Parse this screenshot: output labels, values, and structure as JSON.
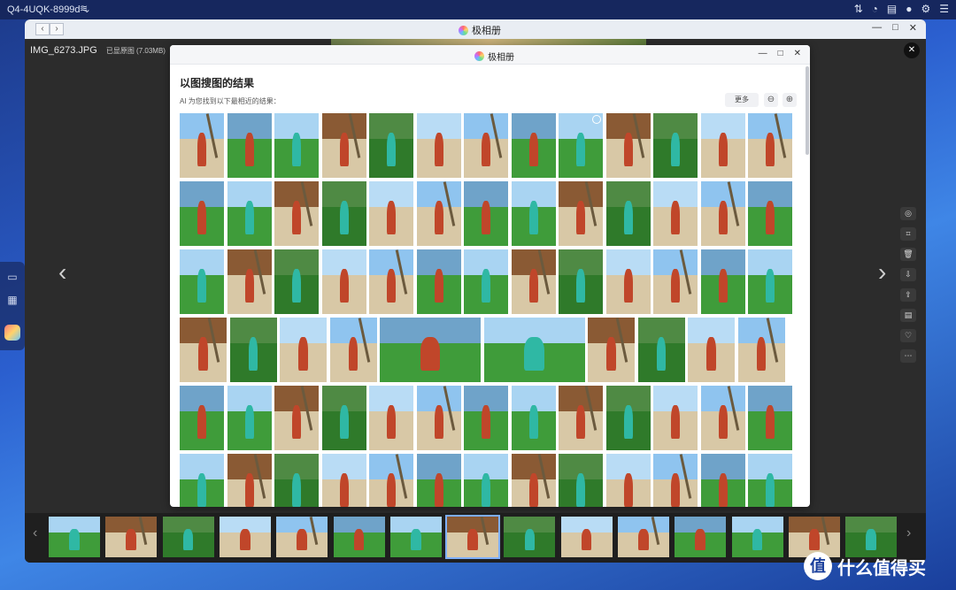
{
  "desktop": {
    "device_name": "Q4-4UQK-8999d",
    "device_chevron": "⌄",
    "wifi_icon": "wifi-icon",
    "top_icons": [
      "transfer-icon",
      "gauge-icon",
      "task-icon",
      "user-icon",
      "gear-icon",
      "menu-icon"
    ]
  },
  "viewer": {
    "title": "极相册",
    "file_name": "IMG_6273.JPG",
    "file_status": "已显原图 (7.03MB)",
    "back_glyph": "‹",
    "forward_glyph": "›",
    "prev_glyph": "‹",
    "next_glyph": "›",
    "close_glyph": "✕",
    "tools": [
      "image-search-icon",
      "crop-icon",
      "trash-icon",
      "download-icon",
      "share-icon",
      "film-icon",
      "heart-icon",
      "more-icon"
    ],
    "tool_glyphs": [
      "◎",
      "⌗",
      "🗑",
      "⇩",
      "⇪",
      "▤",
      "♡",
      "⋯"
    ]
  },
  "dialog": {
    "title": "极相册",
    "heading": "以图搜图的结果",
    "description": "AI 为您找到以下最相近的结果：",
    "more_label": "更多",
    "zoom_out_glyph": "⊖",
    "zoom_in_glyph": "⊕"
  },
  "window_controls": {
    "minimize": "—",
    "maximize": "□",
    "close": "✕"
  },
  "watermark": {
    "logo_glyph": "值",
    "text": "什么值得买"
  },
  "colors": {
    "sky": "#8fc4ef",
    "sand": "#d8c8a6",
    "grass": "#3f9c3a",
    "dress_red": "#c0462a",
    "dress_teal": "#2fb8a4",
    "pavilion": "#8a5a34",
    "selected_outline": "#7fb0ff"
  }
}
